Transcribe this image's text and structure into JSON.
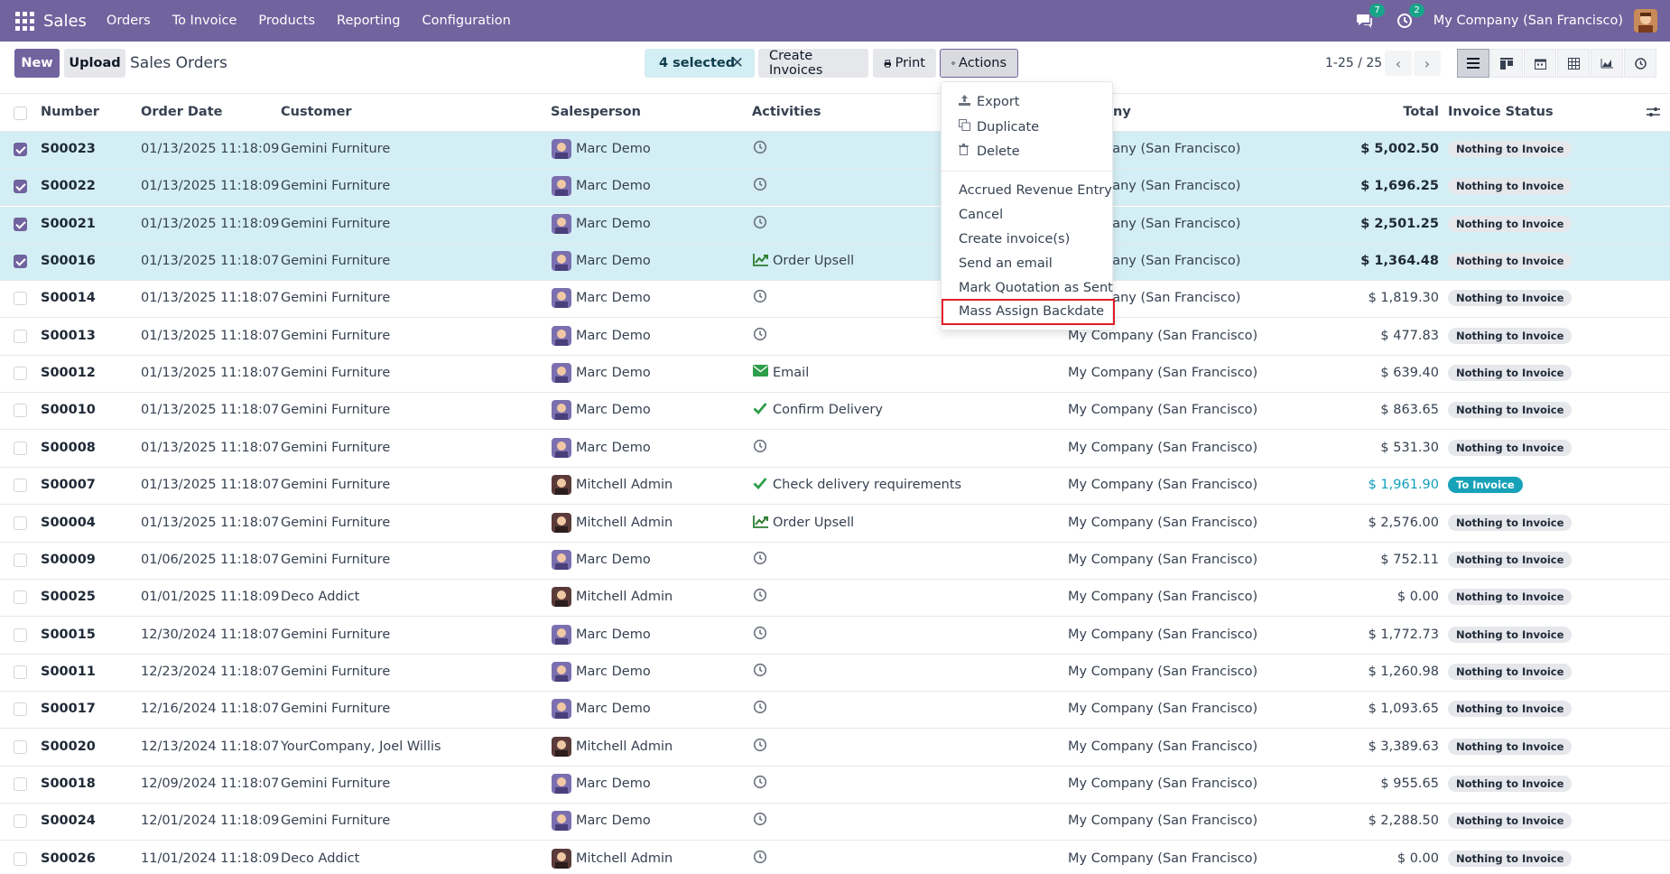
{
  "navbar": {
    "app_name": "Sales",
    "menu": [
      "Orders",
      "To Invoice",
      "Products",
      "Reporting",
      "Configuration"
    ],
    "messages_badge": "7",
    "activities_badge": "2",
    "company": "My Company (San Francisco)"
  },
  "control": {
    "new_label": "New",
    "upload_label": "Upload",
    "title": "Sales Orders",
    "selected_label": "4 selected",
    "create_invoices_label": "Create Invoices",
    "print_label": "Print",
    "actions_label": "Actions",
    "pager": "1-25 / 25"
  },
  "columns": {
    "number": "Number",
    "order_date": "Order Date",
    "customer": "Customer",
    "salesperson": "Salesperson",
    "activities": "Activities",
    "company_partial": "ny",
    "total": "Total",
    "invoice_status": "Invoice Status"
  },
  "rows": [
    {
      "number": "S00023",
      "date": "01/13/2025 11:18:09",
      "customer": "Gemini Furniture",
      "salesperson": "Marc Demo",
      "activity": "",
      "activity_icon": "clock",
      "company": "pany (San Francisco)",
      "total": "$ 5,002.50",
      "status": "Nothing to Invoice",
      "selected": true
    },
    {
      "number": "S00022",
      "date": "01/13/2025 11:18:09",
      "customer": "Gemini Furniture",
      "salesperson": "Marc Demo",
      "activity": "",
      "activity_icon": "clock",
      "company": "pany (San Francisco)",
      "total": "$ 1,696.25",
      "status": "Nothing to Invoice",
      "selected": true
    },
    {
      "number": "S00021",
      "date": "01/13/2025 11:18:09",
      "customer": "Gemini Furniture",
      "salesperson": "Marc Demo",
      "activity": "",
      "activity_icon": "clock",
      "company": "pany (San Francisco)",
      "total": "$ 2,501.25",
      "status": "Nothing to Invoice",
      "selected": true
    },
    {
      "number": "S00016",
      "date": "01/13/2025 11:18:07",
      "customer": "Gemini Furniture",
      "salesperson": "Marc Demo",
      "activity": "Order Upsell",
      "activity_icon": "upsell",
      "company": "pany (San Francisco)",
      "total": "$ 1,364.48",
      "status": "Nothing to Invoice",
      "selected": true
    },
    {
      "number": "S00014",
      "date": "01/13/2025 11:18:07",
      "customer": "Gemini Furniture",
      "salesperson": "Marc Demo",
      "activity": "",
      "activity_icon": "clock",
      "company": "pany (San Francisco)",
      "total": "$ 1,819.30",
      "status": "Nothing to Invoice",
      "selected": false
    },
    {
      "number": "S00013",
      "date": "01/13/2025 11:18:07",
      "customer": "Gemini Furniture",
      "salesperson": "Marc Demo",
      "activity": "",
      "activity_icon": "clock",
      "company": "My Company (San Francisco)",
      "total": "$ 477.83",
      "status": "Nothing to Invoice",
      "selected": false
    },
    {
      "number": "S00012",
      "date": "01/13/2025 11:18:07",
      "customer": "Gemini Furniture",
      "salesperson": "Marc Demo",
      "activity": "Email",
      "activity_icon": "email",
      "company": "My Company (San Francisco)",
      "total": "$ 639.40",
      "status": "Nothing to Invoice",
      "selected": false
    },
    {
      "number": "S00010",
      "date": "01/13/2025 11:18:07",
      "customer": "Gemini Furniture",
      "salesperson": "Marc Demo",
      "activity": "Confirm Delivery",
      "activity_icon": "check",
      "company": "My Company (San Francisco)",
      "total": "$ 863.65",
      "status": "Nothing to Invoice",
      "selected": false
    },
    {
      "number": "S00008",
      "date": "01/13/2025 11:18:07",
      "customer": "Gemini Furniture",
      "salesperson": "Marc Demo",
      "activity": "",
      "activity_icon": "clock",
      "company": "My Company (San Francisco)",
      "total": "$ 531.30",
      "status": "Nothing to Invoice",
      "selected": false
    },
    {
      "number": "S00007",
      "date": "01/13/2025 11:18:07",
      "customer": "Gemini Furniture",
      "salesperson": "Mitchell Admin",
      "activity": "Check delivery requirements",
      "activity_icon": "check",
      "company": "My Company (San Francisco)",
      "total": "$ 1,961.90",
      "status": "To Invoice",
      "selected": false
    },
    {
      "number": "S00004",
      "date": "01/13/2025 11:18:07",
      "customer": "Gemini Furniture",
      "salesperson": "Mitchell Admin",
      "activity": "Order Upsell",
      "activity_icon": "upsell",
      "company": "My Company (San Francisco)",
      "total": "$ 2,576.00",
      "status": "Nothing to Invoice",
      "selected": false
    },
    {
      "number": "S00009",
      "date": "01/06/2025 11:18:07",
      "customer": "Gemini Furniture",
      "salesperson": "Marc Demo",
      "activity": "",
      "activity_icon": "clock",
      "company": "My Company (San Francisco)",
      "total": "$ 752.11",
      "status": "Nothing to Invoice",
      "selected": false
    },
    {
      "number": "S00025",
      "date": "01/01/2025 11:18:09",
      "customer": "Deco Addict",
      "salesperson": "Mitchell Admin",
      "activity": "",
      "activity_icon": "clock",
      "company": "My Company (San Francisco)",
      "total": "$ 0.00",
      "status": "Nothing to Invoice",
      "selected": false
    },
    {
      "number": "S00015",
      "date": "12/30/2024 11:18:07",
      "customer": "Gemini Furniture",
      "salesperson": "Marc Demo",
      "activity": "",
      "activity_icon": "clock",
      "company": "My Company (San Francisco)",
      "total": "$ 1,772.73",
      "status": "Nothing to Invoice",
      "selected": false
    },
    {
      "number": "S00011",
      "date": "12/23/2024 11:18:07",
      "customer": "Gemini Furniture",
      "salesperson": "Marc Demo",
      "activity": "",
      "activity_icon": "clock",
      "company": "My Company (San Francisco)",
      "total": "$ 1,260.98",
      "status": "Nothing to Invoice",
      "selected": false
    },
    {
      "number": "S00017",
      "date": "12/16/2024 11:18:07",
      "customer": "Gemini Furniture",
      "salesperson": "Marc Demo",
      "activity": "",
      "activity_icon": "clock",
      "company": "My Company (San Francisco)",
      "total": "$ 1,093.65",
      "status": "Nothing to Invoice",
      "selected": false
    },
    {
      "number": "S00020",
      "date": "12/13/2024 11:18:07",
      "customer": "YourCompany, Joel Willis",
      "salesperson": "Mitchell Admin",
      "activity": "",
      "activity_icon": "clock",
      "company": "My Company (San Francisco)",
      "total": "$ 3,389.63",
      "status": "Nothing to Invoice",
      "selected": false
    },
    {
      "number": "S00018",
      "date": "12/09/2024 11:18:07",
      "customer": "Gemini Furniture",
      "salesperson": "Marc Demo",
      "activity": "",
      "activity_icon": "clock",
      "company": "My Company (San Francisco)",
      "total": "$ 955.65",
      "status": "Nothing to Invoice",
      "selected": false
    },
    {
      "number": "S00024",
      "date": "12/01/2024 11:18:09",
      "customer": "Gemini Furniture",
      "salesperson": "Marc Demo",
      "activity": "",
      "activity_icon": "clock",
      "company": "My Company (San Francisco)",
      "total": "$ 2,288.50",
      "status": "Nothing to Invoice",
      "selected": false
    },
    {
      "number": "S00026",
      "date": "11/01/2024 11:18:09",
      "customer": "Deco Addict",
      "salesperson": "Mitchell Admin",
      "activity": "",
      "activity_icon": "clock",
      "company": "My Company (San Francisco)",
      "total": "$ 0.00",
      "status": "Nothing to Invoice",
      "selected": false
    }
  ],
  "actions_menu": {
    "export": "Export",
    "duplicate": "Duplicate",
    "delete": "Delete",
    "items": [
      "Accrued Revenue Entry",
      "Cancel",
      "Create invoice(s)",
      "Send an email",
      "Mark Quotation as Sent",
      "Mass Assign Backdate"
    ]
  },
  "colors": {
    "brand": "#71639e",
    "selected_row": "#d3eef4",
    "to_invoice": "#17a2b8",
    "highlight": "#e11d2a"
  }
}
